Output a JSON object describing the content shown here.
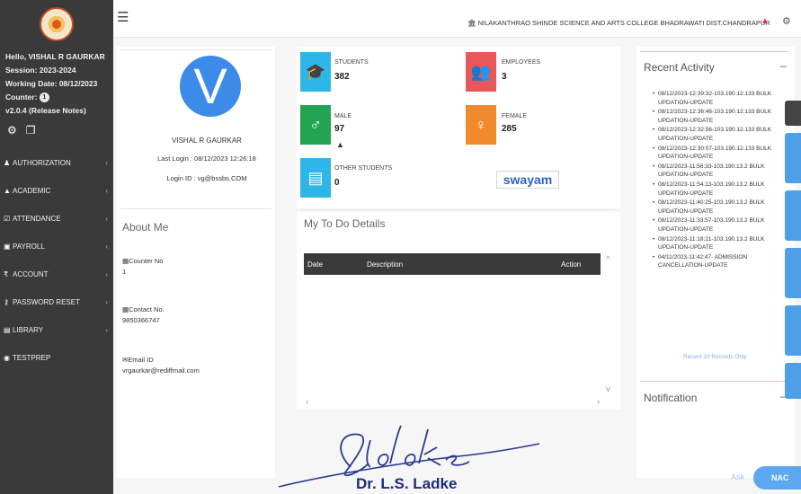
{
  "sidebar": {
    "greeting": "Hello, VISHAL R GAURKAR",
    "session": "Session: 2023-2024",
    "working_date": "Working Date: 08/12/2023",
    "counter_label": "Counter:",
    "counter_value": "1",
    "version": "v2.0.4 (Release Notes)",
    "menu": [
      {
        "label": "AUTHORIZATION",
        "icon": "users-icon"
      },
      {
        "label": "ACADEMIC",
        "icon": "graduation-cap-icon"
      },
      {
        "label": "ATTENDANCE",
        "icon": "checklist-icon"
      },
      {
        "label": "PAYROLL",
        "icon": "money-icon"
      },
      {
        "label": "ACCOUNT",
        "icon": "rupee-icon"
      },
      {
        "label": "PASSWORD RESET",
        "icon": "key-icon"
      },
      {
        "label": "LIBRARY",
        "icon": "book-icon"
      },
      {
        "label": "TESTPREP",
        "icon": "test-icon"
      }
    ]
  },
  "topbar": {
    "college": "NILAKANTHRAO SHINDE SCIENCE AND ARTS COLLEGE BHADRAWATI DIST.CHANDRAPUR"
  },
  "profile": {
    "initial": "V",
    "name": "VISHAL R GAURKAR",
    "last_login": "Last Login : 08/12/2023 12:26:18",
    "login_id": "Login ID : vg@bssbs.COM"
  },
  "about": {
    "title": "About Me",
    "counter_label": "Counter No",
    "counter_value": "1",
    "contact_label": "Contact No.",
    "contact_value": "9850366747",
    "email_label": "Email ID",
    "email_value": "vrgaurkar@rediffmail.com"
  },
  "stats": {
    "students_label": "STUDENTS",
    "students_value": "382",
    "employees_label": "EMPLOYEES",
    "employees_value": "3",
    "male_label": "MALE",
    "male_value": "97",
    "female_label": "FEMALE",
    "female_value": "285",
    "other_label": "OTHER STUDENTS",
    "other_value": "0",
    "swayam": "swayam"
  },
  "todo": {
    "title": "My To Do Details",
    "columns": [
      "Date",
      "Description",
      "Action"
    ]
  },
  "recent": {
    "title": "Recent Activity",
    "items": [
      "08/12/2023-12:39:32-103.190.12.133 BULK UPDATION-UPDATE",
      "08/12/2023-12:36:46-103.190.12.133 BULK UPDATION-UPDATE",
      "08/12/2023-12:32:56-103.190.12.133 BULK UPDATION-UPDATE",
      "08/12/2023-12:30:07-103.190.12.133 BULK UPDATION-UPDATE",
      "08/12/2023-11:56:33-103.190.13.2 BULK UPDATION-UPDATE",
      "08/12/2023-11:54:13-103.190.13.2 BULK UPDATION-UPDATE",
      "08/12/2023-11:40:25-103.190.13.2 BULK UPDATION-UPDATE",
      "08/12/2023-11:33:57-103.190.13.2 BULK UPDATION-UPDATE",
      "08/12/2023-11:18:21-103.190.13.2 BULK UPDATION-UPDATE",
      "04/11/2023-11:42:47- ADMISSION CANCELLATION-UPDATE"
    ],
    "more": "Recent 10 Records Only"
  },
  "notification": {
    "title": "Notification"
  },
  "ask": {
    "label": "Ask",
    "button": "NAC"
  },
  "signature": {
    "name": "Dr. L.S. Ladke",
    "script": "Sladke"
  },
  "colors": {
    "sidebar": "#3a3a3a",
    "students": "#2fb6e9",
    "employees": "#e8575a",
    "male": "#22a452",
    "female": "#f08a2c",
    "other": "#2fb6e9",
    "avatar": "#3d8be8"
  }
}
